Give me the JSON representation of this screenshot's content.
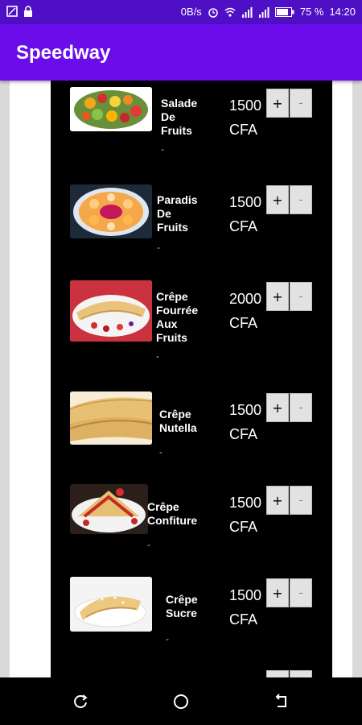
{
  "status_bar": {
    "network_speed": "0B/s",
    "battery": "75 %",
    "time": "14:20",
    "icons": [
      "screenshot-icon",
      "lock-icon",
      "alarm-icon",
      "wifi-icon",
      "signal-icon",
      "signal-icon",
      "battery-icon"
    ]
  },
  "app": {
    "title": "Speedway"
  },
  "items": [
    {
      "name": "Salade\nDe\nFruits",
      "dash": "-",
      "price_amount": "1500",
      "currency": "CFA",
      "plus": "+",
      "minus": "-",
      "image": "fruit-salad-image"
    },
    {
      "name": "Paradis\nDe\nFruits",
      "dash": "-",
      "price_amount": "1500",
      "currency": "CFA",
      "plus": "+",
      "minus": "-",
      "image": "fruit-platter-image"
    },
    {
      "name": "Crêpe\nFourrée\nAux\nFruits",
      "dash": "-",
      "price_amount": "2000",
      "currency": "CFA",
      "plus": "+",
      "minus": "-",
      "image": "fruit-crepe-image"
    },
    {
      "name": "Crêpe\nNutella",
      "dash": "-",
      "price_amount": "1500",
      "currency": "CFA",
      "plus": "+",
      "minus": "-",
      "image": "nutella-crepe-image"
    },
    {
      "name": "Crêpe\nConfiture",
      "dash": "-",
      "price_amount": "1500",
      "currency": "CFA",
      "plus": "+",
      "minus": "-",
      "image": "jam-crepe-image"
    },
    {
      "name": "Crêpe\nSucre",
      "dash": "-",
      "price_amount": "1500",
      "currency": "CFA",
      "plus": "+",
      "minus": "-",
      "image": "sugar-crepe-image"
    }
  ],
  "nav_bar": {
    "icons": [
      "recent-apps-icon",
      "home-icon",
      "back-icon"
    ]
  },
  "colors": {
    "status_bar": "#4f0fc4",
    "app_bar": "#6a0dea",
    "list_background": "#000000",
    "button": "#e2e2e2"
  }
}
